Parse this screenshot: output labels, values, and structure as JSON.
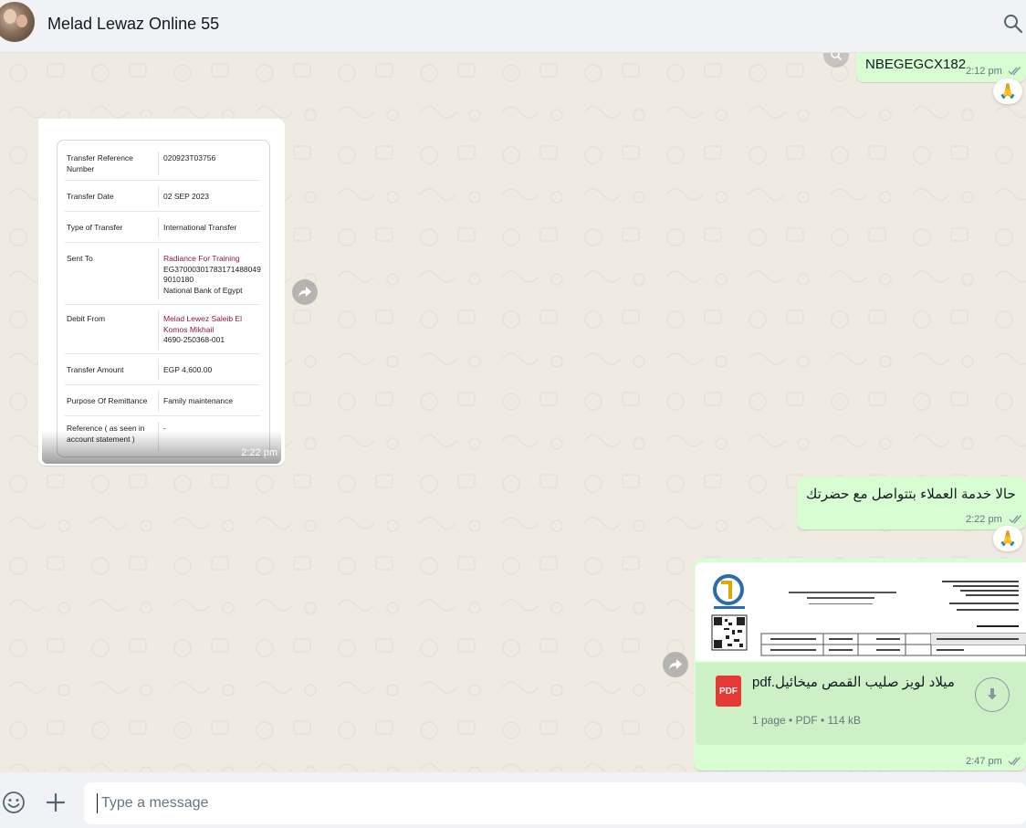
{
  "header": {
    "contact_name": "Melad Lewaz Online 55"
  },
  "messages": {
    "ref_code": {
      "text": "NBEGEGCX182",
      "time": "2:12 pm",
      "reaction": "🙏"
    },
    "receipt": {
      "time": "2:22 pm",
      "rows": [
        {
          "label": "Transfer Reference Number",
          "value": "020923T03756"
        },
        {
          "label": "Transfer Date",
          "value": "02 SEP 2023"
        },
        {
          "label": "Type of Transfer",
          "value": "International Transfer"
        },
        {
          "label": "Sent To",
          "value_hl": "Radiance For Training",
          "value": "EG370003017831714880499010180",
          "value2": "National Bank of Egypt"
        },
        {
          "label": "Debit From",
          "value_hl": "Melad Lewez Saleib El Komos Mikhail",
          "value": "4690-250368-001"
        },
        {
          "label": "Transfer Amount",
          "value": "EGP 4,600.00"
        },
        {
          "label": "Purpose Of Remittance",
          "value": "Family maintenance"
        },
        {
          "label": "Reference ( as seen in account statement )",
          "value": "-"
        }
      ]
    },
    "customer_service": {
      "text": "حالا خدمة العملاء بتتواصل مع حضرتك",
      "time": "2:22 pm",
      "reaction": "🙏"
    },
    "document": {
      "file_name": "ميلاد لويز صليب القمص ميخائيل.pdf",
      "pages": "1 page",
      "type": "PDF",
      "size": "114 kB",
      "icon_label": "PDF",
      "time": "2:47 pm"
    }
  },
  "composer": {
    "placeholder": "Type a message"
  },
  "colors": {
    "outgoing_bubble": "#d9fdd3",
    "incoming_bubble": "#ffffff",
    "chat_background": "#efeae2",
    "ticks": "#8696a0",
    "pdf_red": "#e53935"
  }
}
